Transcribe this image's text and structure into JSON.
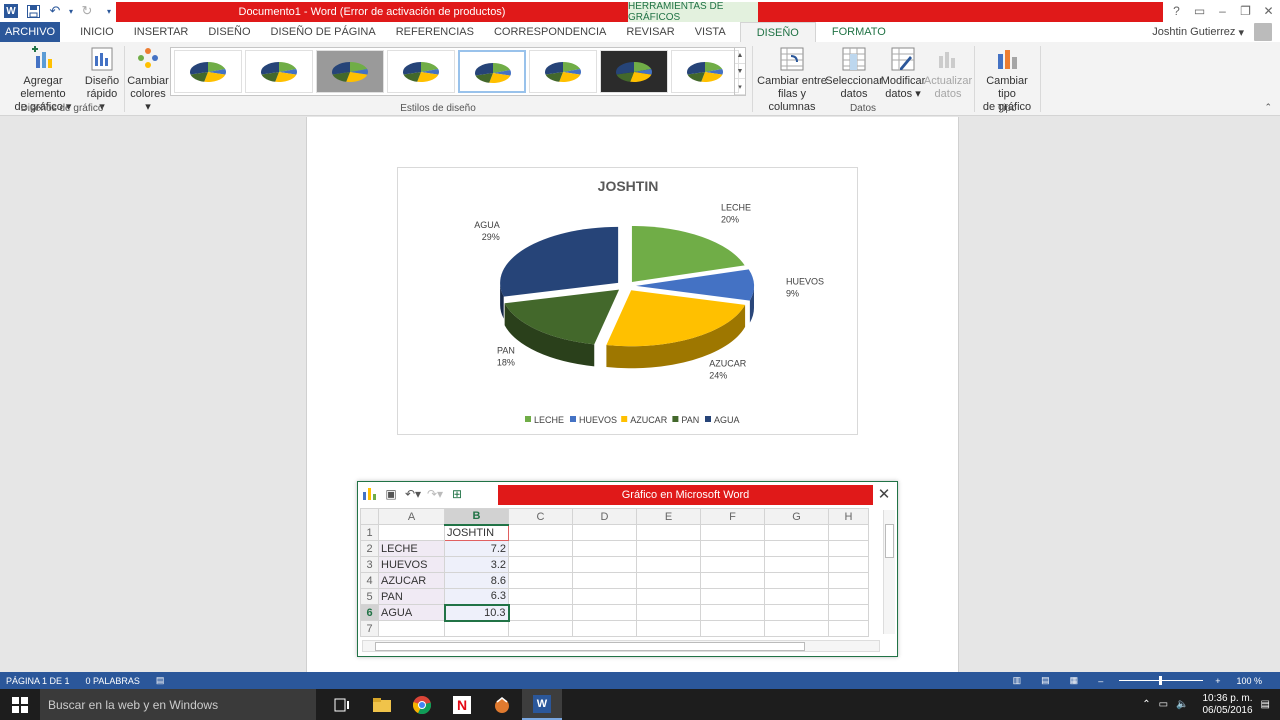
{
  "app": {
    "title": "Documento1 - Word (Error de activación de productos)",
    "tools_header": "HERRAMIENTAS DE GRÁFICOS",
    "user": "Joshtin Gutierrez"
  },
  "tabs": [
    "ARCHIVO",
    "INICIO",
    "INSERTAR",
    "DISEÑO",
    "DISEÑO DE PÁGINA",
    "REFERENCIAS",
    "CORRESPONDENCIA",
    "REVISAR",
    "VISTA",
    "DISEÑO",
    "FORMATO"
  ],
  "ribbon": {
    "add_element": [
      "Agregar elemento",
      "de gráfico"
    ],
    "quick_layout": [
      "Diseño",
      "rápido"
    ],
    "change_colors": [
      "Cambiar",
      "colores"
    ],
    "switch_rows": [
      "Cambiar entre",
      "filas y columnas"
    ],
    "select_data": [
      "Seleccionar",
      "datos"
    ],
    "edit_data": [
      "Modificar",
      "datos"
    ],
    "refresh_data": [
      "Actualizar",
      "datos"
    ],
    "change_type": [
      "Cambiar tipo",
      "de gráfico"
    ],
    "groups": {
      "layouts": "Diseños de gráfico",
      "styles": "Estilos de diseño",
      "data": "Datos",
      "type": "Tipo"
    }
  },
  "chart_data": {
    "type": "pie",
    "title": "JOSHTIN",
    "categories": [
      "LECHE",
      "HUEVOS",
      "AZUCAR",
      "PAN",
      "AGUA"
    ],
    "values": [
      7.2,
      3.2,
      8.6,
      6.3,
      10.3
    ],
    "percent_labels": [
      "20%",
      "9%",
      "24%",
      "18%",
      "29%"
    ],
    "colors": [
      "#70ad47",
      "#4472c4",
      "#ffc000",
      "#43682b",
      "#264478"
    ],
    "legend": "bottom",
    "style": "3d-exploded"
  },
  "excel": {
    "title": "Gráfico en Microsoft Word",
    "columns": [
      "A",
      "B",
      "C",
      "D",
      "E",
      "F",
      "G",
      "H"
    ],
    "rows": [
      "1",
      "2",
      "3",
      "4",
      "5",
      "6",
      "7"
    ],
    "header": "JOSHTIN",
    "labels": [
      "LECHE",
      "HUEVOS",
      "AZUCAR",
      "PAN",
      "AGUA"
    ],
    "values": [
      "7.2",
      "3.2",
      "8.6",
      "6.3",
      "10.3"
    ]
  },
  "status": {
    "page": "PÁGINA 1 DE 1",
    "words": "0 PALABRAS",
    "zoom": "100 %"
  },
  "taskbar": {
    "search_placeholder": "Buscar en la web y en Windows",
    "time": "10:36 p. m.",
    "date": "06/05/2016"
  }
}
